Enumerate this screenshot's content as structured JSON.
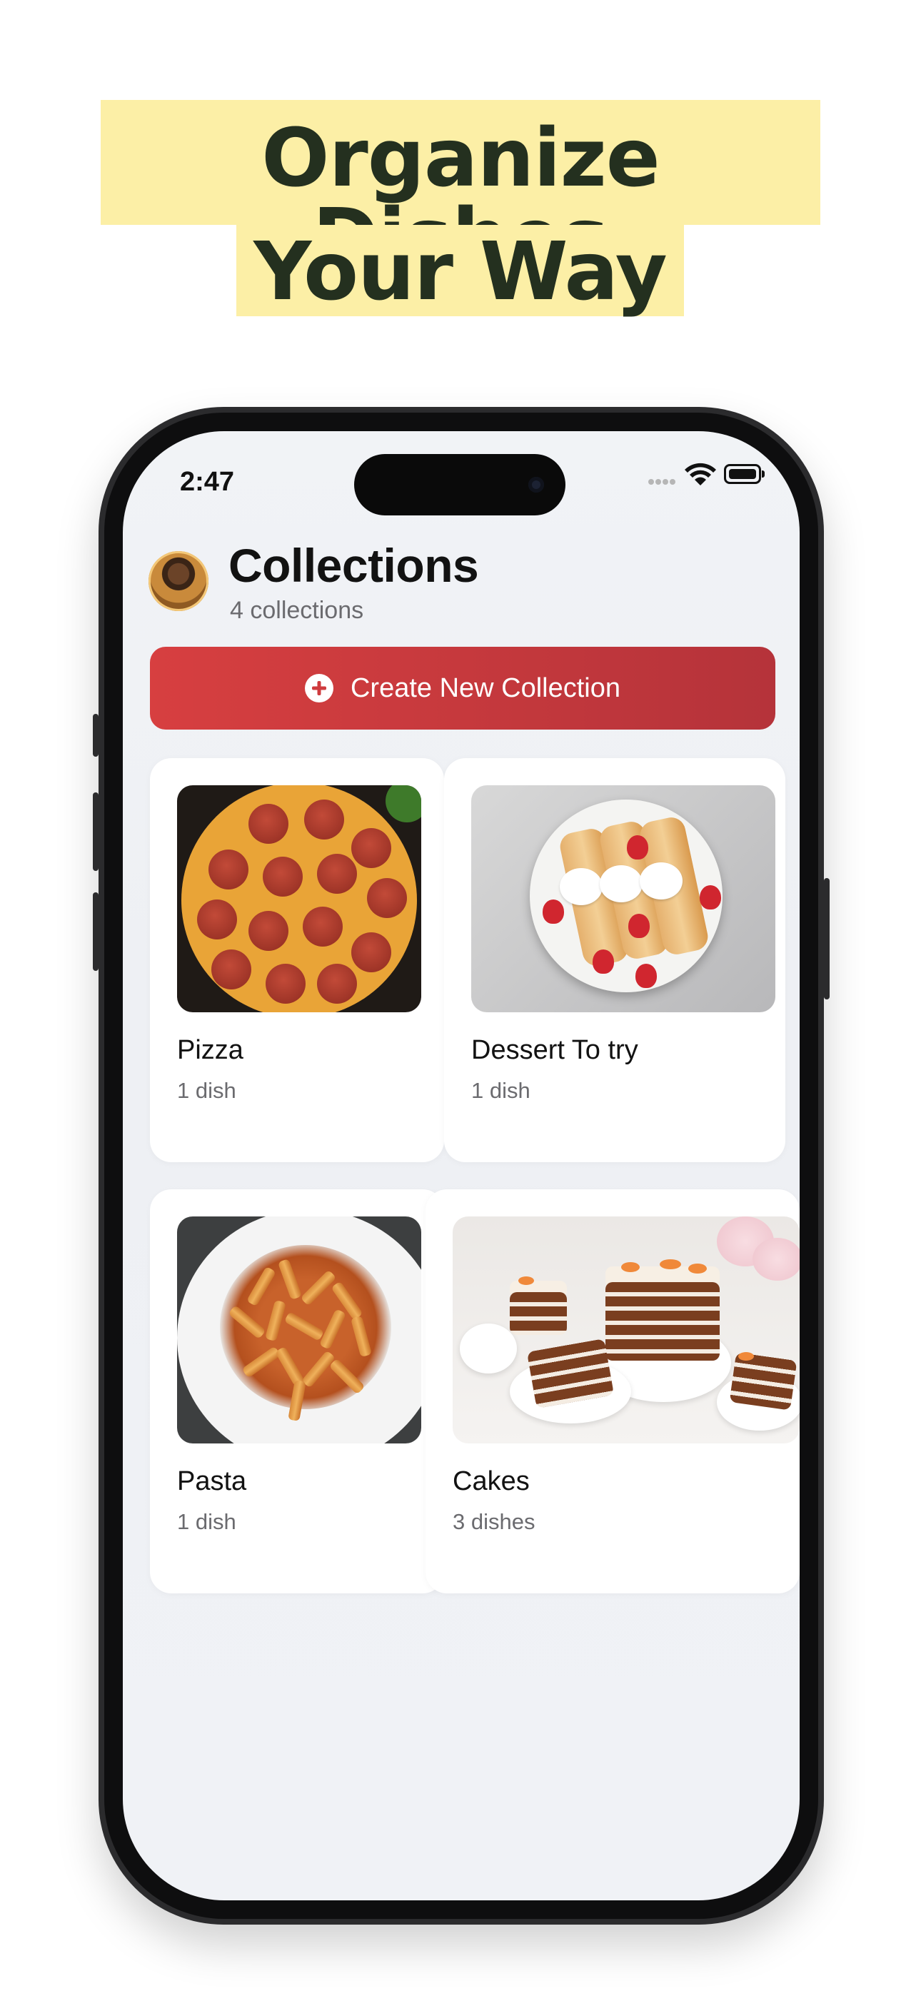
{
  "headline": {
    "line1": "Organize Dishes",
    "line2": "Your Way",
    "highlight_color": "#fcefa6",
    "text_color": "#24301f"
  },
  "status_bar": {
    "time": "2:47",
    "icons": [
      "signal-dots-icon",
      "wifi-icon",
      "battery-icon"
    ]
  },
  "header": {
    "title": "Collections",
    "subtitle": "4 collections",
    "avatar": "avatar"
  },
  "create_button": {
    "label": "Create New Collection",
    "icon": "plus-circle-icon",
    "color": "#d03c3f"
  },
  "collections": [
    {
      "name": "Pizza",
      "count": "1 dish",
      "image": "pepperoni-pizza-photo"
    },
    {
      "name": "Dessert To try",
      "count": "1 dish",
      "image": "crepes-with-strawberries-photo"
    },
    {
      "name": "Pasta",
      "count": "1 dish",
      "image": "penne-pasta-photo"
    },
    {
      "name": "Cakes",
      "count": "3 dishes",
      "image": "carrot-cakes-photo"
    }
  ]
}
